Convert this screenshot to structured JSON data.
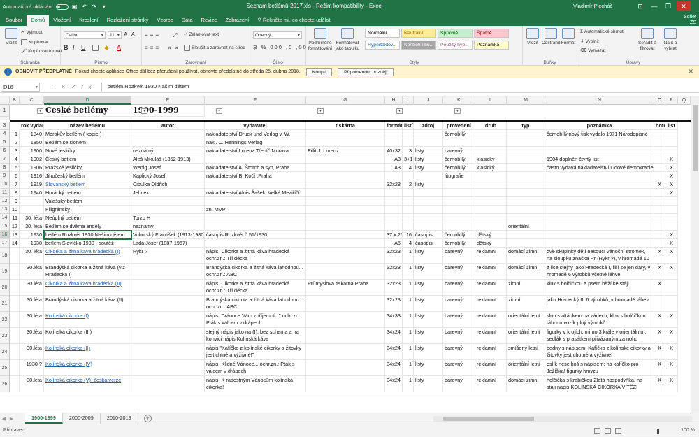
{
  "window": {
    "autosave_label": "Automatické ukládání",
    "doc_title": "Seznam betlémů-2017.xls  -  Režim kompatibility  -  Excel",
    "user": "Vladimír Plecháč",
    "min": "—",
    "restore": "❐",
    "close": "✕",
    "share_label": "Sdílet",
    "share_key": "ZS"
  },
  "tabs": [
    {
      "label": "Soubor",
      "key": "S"
    },
    {
      "label": "Domů",
      "key": "D"
    },
    {
      "label": "Vložení",
      "key": "O"
    },
    {
      "label": "Kreslení",
      "key": "C"
    },
    {
      "label": "Rozložení stránky",
      "key": "R"
    },
    {
      "label": "Vzorce",
      "key": "V"
    },
    {
      "label": "Data",
      "key": "A"
    },
    {
      "label": "Revize",
      "key": "E"
    },
    {
      "label": "Zobrazení",
      "key": "Z"
    }
  ],
  "tell_me": "Řekněte mi, co chcete udělat.",
  "ribbon": {
    "clipboard": {
      "label": "Schránka",
      "paste": "Vložit",
      "cut": "Vyjmout",
      "copy": "Kopírovat",
      "format_painter": "Kopírovat formát"
    },
    "font": {
      "label": "Písmo",
      "name": "Calibri",
      "size": "11"
    },
    "alignment": {
      "label": "Zarovnání",
      "wrap": "Zalamovat text",
      "merge": "Sloučit a zarovnat na střed"
    },
    "number": {
      "label": "Číslo",
      "format": "Obecný"
    },
    "styles": {
      "label": "Styly",
      "cond_format": "Podmíněné formátování",
      "format_table": "Formátovat jako tabulku",
      "items": [
        {
          "label": "Normální",
          "bg": "#ffffff",
          "fg": "#000000"
        },
        {
          "label": "Neutrální",
          "bg": "#ffeb9c",
          "fg": "#9c6500"
        },
        {
          "label": "Správně",
          "bg": "#c6efce",
          "fg": "#006100"
        },
        {
          "label": "Špatně",
          "bg": "#ffc7ce",
          "fg": "#9c0006"
        },
        {
          "label": "Hypertextov...",
          "bg": "#ffffff",
          "fg": "#0563c1"
        },
        {
          "label": "Kontrolní bu...",
          "bg": "#a5a5a5",
          "fg": "#ffffff"
        },
        {
          "label": "Použitý hyp...",
          "bg": "#ffffff",
          "fg": "#954f72"
        },
        {
          "label": "Poznámka",
          "bg": "#ffffcc",
          "fg": "#000000"
        }
      ]
    },
    "cells": {
      "label": "Buňky",
      "insert": "Vložit",
      "delete": "Odstranit",
      "format": "Formát"
    },
    "editing": {
      "label": "Úpravy",
      "autosum": "Automatické shrnutí",
      "fill": "Vyplnit",
      "clear": "Vymazat",
      "sort": "Seřadit a filtrovat",
      "find": "Najít a vybrat"
    }
  },
  "message_bar": {
    "title": "OBNOVIT PŘEDPLATNÉ",
    "text": "Pokud chcete aplikace Office dál bez přerušení používat, obnovte předplatné do středa 25. dubna 2018.",
    "renew": "Koupit",
    "remind": "Připomenout později"
  },
  "formula_bar": {
    "name_box": "D16",
    "formula": "betlém Rozkvět 1930 Našim dětem"
  },
  "columns": [
    "B",
    "C",
    "D",
    "E",
    "F",
    "G",
    "H",
    "I",
    "J",
    "K",
    "L",
    "M",
    "N",
    "O",
    "P",
    "Q"
  ],
  "selected_column": "D",
  "title_row": {
    "heading": "České betlémy",
    "period": "1900-1999"
  },
  "headers": [
    "rok vydání",
    "název betlému",
    "autor",
    "vydavatel",
    "tiskárna",
    "formát",
    "listů",
    "zdroj",
    "provedení",
    "druh",
    "typ",
    "poznámka",
    "hotov",
    "list"
  ],
  "rows": [
    {
      "row": "4",
      "b": "1",
      "c": "1840",
      "d": "Morakův betlém ( kopie )",
      "e": "",
      "f": "nakladatelství Druck und Verlag v. W. Morak in Prag",
      "g": "",
      "h": "",
      "i": "",
      "j": "",
      "k": "černobílý",
      "l": "",
      "m": "",
      "n": "černobílý nový tisk vydalo 1971 Národopisné muzeum v Praze",
      "o": "",
      "p": ""
    },
    {
      "row": "5",
      "b": "2",
      "c": "1850",
      "d": "Betlém se slonem",
      "e": "",
      "f": "nakl. C. Hennings Verlag",
      "g": "",
      "h": "",
      "i": "",
      "j": "",
      "k": "",
      "l": "",
      "m": "",
      "n": "",
      "o": "",
      "p": ""
    },
    {
      "row": "6",
      "b": "3",
      "c": "1900",
      "d": "Nové jesličky",
      "e": "neznámý",
      "f": "nakladatelství Lorenz Třebíč Morava",
      "g": "Edit.J. Lorenz",
      "h": "40x32",
      "i": "3",
      "j": "listy",
      "k": "barevný",
      "l": "",
      "m": "",
      "n": "",
      "o": "",
      "p": ""
    },
    {
      "row": "7",
      "b": "4",
      "c": "1902",
      "d": "Český betlém",
      "e": "Aleš Mikuláš (1852-1913)",
      "f": "",
      "g": "",
      "h": "A3",
      "i": "3+1",
      "j": "listy",
      "k": "černobílý",
      "l": "klasický",
      "m": "",
      "n": "1904 doplněn čtvrtý list",
      "o": "",
      "p": "X"
    },
    {
      "row": "8",
      "b": "5",
      "c": "1906",
      "d": "Pražské jesličky",
      "e": "Wenig Josef",
      "f": "nakladatelství A. Štorch a syn, Praha",
      "g": "",
      "h": "A3",
      "i": "4",
      "j": "listy",
      "k": "černobílý",
      "l": "klasický",
      "m": "",
      "n": "často vydává nakladatelství Lidové demokracie-",
      "o": "",
      "p": "X"
    },
    {
      "row": "9",
      "b": "6",
      "c": "1916",
      "d": "Jihočeský betlém",
      "e": "Kaplický Josef",
      "f": "nakladatelství B. Kočí ,Praha",
      "g": "",
      "h": "",
      "i": "",
      "j": "",
      "k": "litografie",
      "l": "",
      "m": "",
      "n": "",
      "o": "",
      "p": "X"
    },
    {
      "row": "10",
      "b": "7",
      "c": "1919",
      "d": "Slovanský betlém",
      "e": "Cibulka Oldřich",
      "f": "",
      "g": "",
      "h": "32x28",
      "i": "2",
      "j": "listy",
      "k": "",
      "l": "",
      "m": "",
      "n": "",
      "o": "X",
      "p": "X",
      "link": true
    },
    {
      "row": "11",
      "b": "8",
      "c": "1940",
      "d": "Horácký betlém",
      "e": "Jelínek",
      "f": "nakladatelství Alois Šašek, Velké Meziříčí",
      "g": "",
      "h": "",
      "i": "",
      "j": "",
      "k": "",
      "l": "",
      "m": "",
      "n": "",
      "o": "",
      "p": "X"
    },
    {
      "row": "12",
      "b": "9",
      "c": "",
      "d": "Valašský betlém",
      "e": "",
      "f": "",
      "g": "",
      "h": "",
      "i": "",
      "j": "",
      "k": "",
      "l": "",
      "m": "",
      "n": "",
      "o": "",
      "p": ""
    },
    {
      "row": "13",
      "b": "10",
      "c": "",
      "d": "Filigránský",
      "e": "",
      "f": "zn. MVP",
      "g": "",
      "h": "",
      "i": "",
      "j": "",
      "k": "",
      "l": "",
      "m": "",
      "n": "",
      "o": "",
      "p": ""
    },
    {
      "row": "14",
      "b": "11",
      "c": "30. léta",
      "d": "Neúplný betlém",
      "e": "Torzo H",
      "f": "",
      "g": "",
      "h": "",
      "i": "",
      "j": "",
      "k": "",
      "l": "",
      "m": "",
      "n": "",
      "o": "",
      "p": ""
    },
    {
      "row": "15",
      "b": "12",
      "c": "30. léta",
      "d": "Betlém se dvěma anděly",
      "e": "neznámý",
      "f": "",
      "g": "",
      "h": "",
      "i": "",
      "j": "",
      "k": "",
      "l": "",
      "m": "orientální",
      "n": "",
      "o": "",
      "p": ""
    },
    {
      "row": "16",
      "b": "13",
      "c": "1930",
      "d": "betlém Rozkvět 1930 Našim dětem",
      "e": "Voborský František (1913-1980)",
      "f": "časopis Rozkvět č.51/1930",
      "g": "",
      "h": "37 x 26",
      "i": "16",
      "j": "časopis",
      "k": "černobílý",
      "l": "dětský",
      "m": "",
      "n": "",
      "o": "",
      "p": "X",
      "active": true
    },
    {
      "row": "17",
      "b": "14",
      "c": "1930",
      "d": "betlém Slovíčko 1930 - soutěž",
      "e": "Lada Josef  (1887-1957)",
      "f": "",
      "g": "",
      "h": "A5",
      "i": "4",
      "j": "časopis",
      "k": "černobílý",
      "l": "dětský",
      "m": "",
      "n": "",
      "o": "",
      "p": "X"
    },
    {
      "row": "18",
      "b": "",
      "c": "30. léta",
      "d": "Cikorka a žitná káva hradecká (I)",
      "e": "Rykr ?",
      "f": "nápis: Cikorka a žitná káva hradecká  ochr.zn.: Tři děcka",
      "g": "",
      "h": "32x23",
      "i": "1",
      "j": "listy",
      "k": "barevný",
      "l": "reklamní",
      "m": "domácí    zimní",
      "n": "dvě skupinky dětí nesoucí  vánoční stromek, na sloupku značka Rr (Rykr ?), v hromadě 10 darů",
      "o": "X",
      "p": "X",
      "link": true,
      "tall": true
    },
    {
      "row": "19",
      "b": "",
      "c": "30.léta",
      "d": "Brandýská cikorka a žitná káva (viz Hradecká I)",
      "e": "",
      "f": "Brandýská cikorka a žitná káva lahodnou...  ochr.zn.: ABC",
      "g": "",
      "h": "32x23",
      "i": "1",
      "j": "listy",
      "k": "barevný",
      "l": "reklamní",
      "m": "domácí    zimní",
      "n": "z lice stejný jako Hradecká I, liší se jen dary, v hromadě 6 výrobků včetně láhve",
      "o": "X",
      "p": "X",
      "tall": true
    },
    {
      "row": "20",
      "b": "",
      "c": "30.léta",
      "d": "Cikorka a žitná káva hradecká (II)",
      "e": "",
      "f": "nápis: Cikorka a žitná káva hradecká  ochr.zn.: Tři děcka",
      "g": "Průmyslová tiskárna Praha",
      "h": "32x23",
      "i": "1",
      "j": "listy",
      "k": "barevný",
      "l": "reklamní",
      "m": "zimní",
      "n": "kluk s holčičkou a psem běží ke stáji",
      "o": "X",
      "p": "",
      "link": true,
      "tall": true
    },
    {
      "row": "21",
      "b": "",
      "c": "30.léta",
      "d": "Brandýská cikorka a žitná káva (II)",
      "e": "",
      "f": "Brandýská cikorka a žitná káva lahodnou...  ochr.zn.: ABC",
      "g": "",
      "h": "32x23",
      "i": "1",
      "j": "listy",
      "k": "barevný",
      "l": "reklamní",
      "m": "zimní",
      "n": "jako Hradecký II, 6 výrobků, v hromadě láhev",
      "o": "",
      "p": "",
      "tall": true
    },
    {
      "row": "22",
      "b": "",
      "c": "30.léta",
      "d": "Kolínská cikorka (I)",
      "e": "",
      "f": "nápis: \"Vánoce Vám zpříjemní...\"  ochr.zn.: Pták s válcem v drápech",
      "g": "",
      "h": "34x33",
      "i": "1",
      "j": "listy",
      "k": "barevný",
      "l": "reklamní",
      "m": "orientální letní",
      "n": "slon s altánkem na zádech, kluk s holčičkou táhnou vozík plný výrobků",
      "o": "X",
      "p": "X",
      "link": true,
      "tall": true
    },
    {
      "row": "23",
      "b": "",
      "c": "30.léta",
      "d": "Kolínská cikorka (III)",
      "e": "",
      "f": "stejný nápis jako na (I), bez schema a na konvici nápis Kolínská káva",
      "g": "",
      "h": "34x24",
      "i": "1",
      "j": "listy",
      "k": "barevný",
      "l": "reklamní",
      "m": "orientální letní",
      "n": "figurky v krojích, mimo 3 krále v orientálním, sedlák s prasátkem přivázaným za nohu",
      "o": "X",
      "p": "X",
      "tall": true
    },
    {
      "row": "24",
      "b": "",
      "c": "30.léta",
      "d": "Kolínská cikorka (II)",
      "e": "",
      "f": "nápis \"Kafíčko z kolínské cikorky a žitovky jest chtné a výživné!\"",
      "g": "",
      "h": "34x24",
      "i": "1",
      "j": "listy",
      "k": "barevný",
      "l": "reklamní",
      "m": "smíšený    letní",
      "n": "bedny s nápisem: Kafíčko z kolínské cikorky a žitovky jest chotné a výživné!",
      "o": "X",
      "p": "X",
      "link": true,
      "tall": true
    },
    {
      "row": "25",
      "b": "",
      "c": "1930 ?",
      "d": "Kolínská cikorka (IV)",
      "e": "",
      "f": "nápis: Klidné Vánoce...  ochr.zn.: Pták s válcem v drápech",
      "g": "",
      "h": "34x24",
      "i": "1",
      "j": "listy",
      "k": "barevný",
      "l": "reklamní",
      "m": "orientální letní",
      "n": "oslík nese koš s nápisem: na kafíčko pro Ježíška! figurky hmyzu",
      "o": "X",
      "p": "X",
      "link": true,
      "tall": true
    },
    {
      "row": "26",
      "b": "",
      "c": "30.léta",
      "d": "Kolínská cikorka (V)- česká verze",
      "e": "",
      "f": "nápis: K radostným Vánocům kolínská cikorka!",
      "g": "",
      "h": "34x24",
      "i": "1",
      "j": "listy",
      "k": "barevný",
      "l": "reklamní",
      "m": "domácí    zimní",
      "n": "holčička s krabičkou Zlatá hospodyňka, na stáji nápis KOLÍNSKÁ CIKORKA VÍTĚZÍ JAKOSTÍ!",
      "o": "X",
      "p": "X",
      "link": true,
      "tall": true
    }
  ],
  "sheets": [
    {
      "label": "1900-1999",
      "active": true
    },
    {
      "label": "2000-2009",
      "active": false
    },
    {
      "label": "2010-2019",
      "active": false
    }
  ],
  "add_sheet": "+",
  "status": {
    "ready": "Připraven",
    "zoom": "100 %"
  }
}
